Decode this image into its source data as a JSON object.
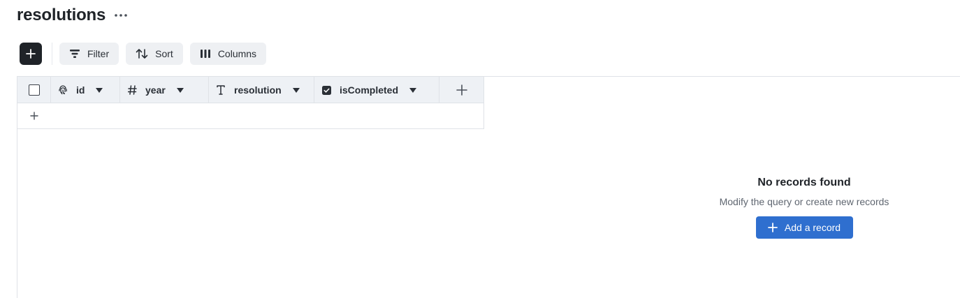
{
  "page": {
    "title": "resolutions"
  },
  "toolbar": {
    "filter_label": "Filter",
    "sort_label": "Sort",
    "columns_label": "Columns"
  },
  "grid": {
    "columns": [
      {
        "label": "id",
        "icon": "fingerprint-icon"
      },
      {
        "label": "year",
        "icon": "hash-icon"
      },
      {
        "label": "resolution",
        "icon": "text-type-icon"
      },
      {
        "label": "isCompleted",
        "icon": "checkbox-checked-icon"
      }
    ]
  },
  "empty_state": {
    "title": "No records found",
    "subtitle": "Modify the query or create new records",
    "button_label": "Add a record"
  },
  "colors": {
    "accent": "#2f6fcf",
    "dark_button": "#1f2328",
    "header_bg": "#eef1f5",
    "tool_button_bg": "#eef0f3"
  }
}
